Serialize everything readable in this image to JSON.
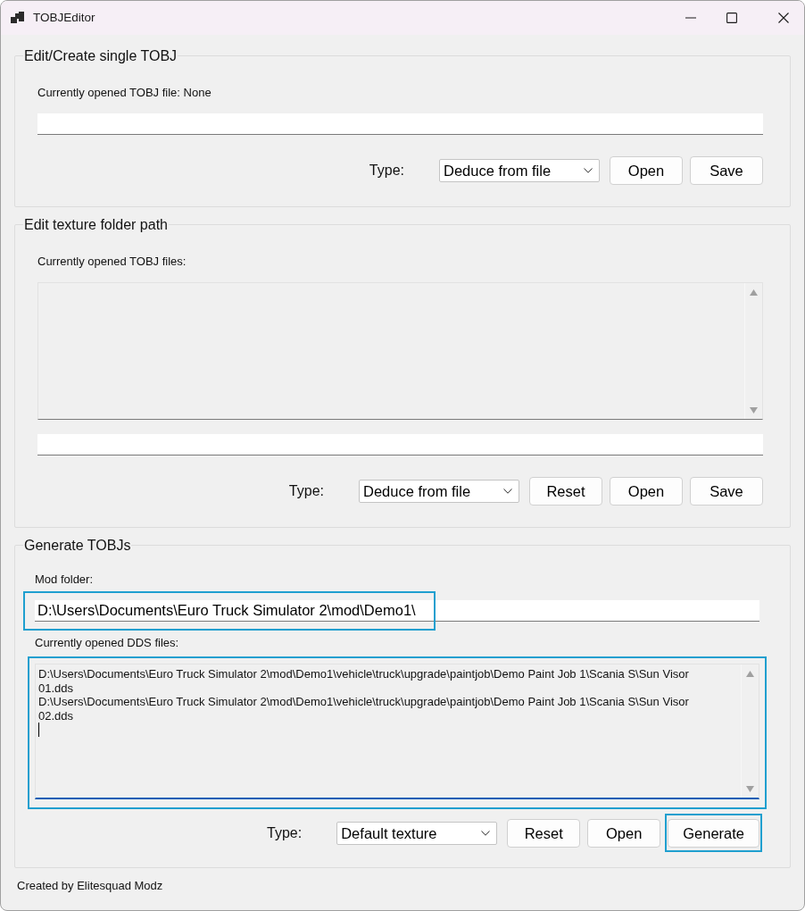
{
  "window": {
    "title": "TOBJEditor"
  },
  "groups": [
    {
      "title": "Edit/Create single TOBJ",
      "parts": [
        {
          "kind": "label",
          "text": "Currently opened TOBJ file: None"
        },
        {
          "kind": "field",
          "highlighted": false
        },
        {
          "kind": "actions",
          "type_label": "Type:",
          "dropdown": "Deduce from file",
          "buttons": [
            {
              "label": "Open",
              "highlighted": false
            },
            {
              "label": "Save",
              "highlighted": false
            }
          ]
        }
      ]
    },
    {
      "title": "Edit texture folder path",
      "parts": [
        {
          "kind": "label",
          "text": "Currently opened TOBJ files:"
        },
        {
          "kind": "list",
          "focused": false,
          "highlighted": false
        },
        {
          "kind": "field",
          "highlighted": false
        },
        {
          "kind": "actions",
          "type_label": "Type:",
          "dropdown": "Deduce from file",
          "buttons": [
            {
              "label": "Reset",
              "highlighted": false
            },
            {
              "label": "Open",
              "highlighted": false
            },
            {
              "label": "Save",
              "highlighted": false
            }
          ]
        }
      ]
    },
    {
      "title": "Generate TOBJs",
      "parts": [
        {
          "kind": "label",
          "text": "Mod folder:"
        },
        {
          "kind": "field",
          "value": "D:\\Users\\Documents\\Euro Truck Simulator 2\\mod\\Demo1\\",
          "highlighted": true
        },
        {
          "kind": "label",
          "text": "Currently opened DDS files:"
        },
        {
          "kind": "list",
          "lines": [
            "D:\\Users\\Documents\\Euro Truck Simulator 2\\mod\\Demo1\\vehicle\\truck\\upgrade\\paintjob\\Demo Paint Job 1\\Scania S\\Sun Visor 01.dds",
            "D:\\Users\\Documents\\Euro Truck Simulator 2\\mod\\Demo1\\vehicle\\truck\\upgrade\\paintjob\\Demo Paint Job 1\\Scania S\\Sun Visor 02.dds"
          ],
          "focused": true,
          "highlighted": true
        },
        {
          "kind": "actions",
          "type_label": "Type:",
          "dropdown": "Default texture",
          "buttons": [
            {
              "label": "Reset",
              "highlighted": false
            },
            {
              "label": "Open",
              "highlighted": false
            },
            {
              "label": "Generate",
              "highlighted": true
            }
          ]
        }
      ]
    }
  ],
  "status_text": "Created by Elitesquad Modz"
}
